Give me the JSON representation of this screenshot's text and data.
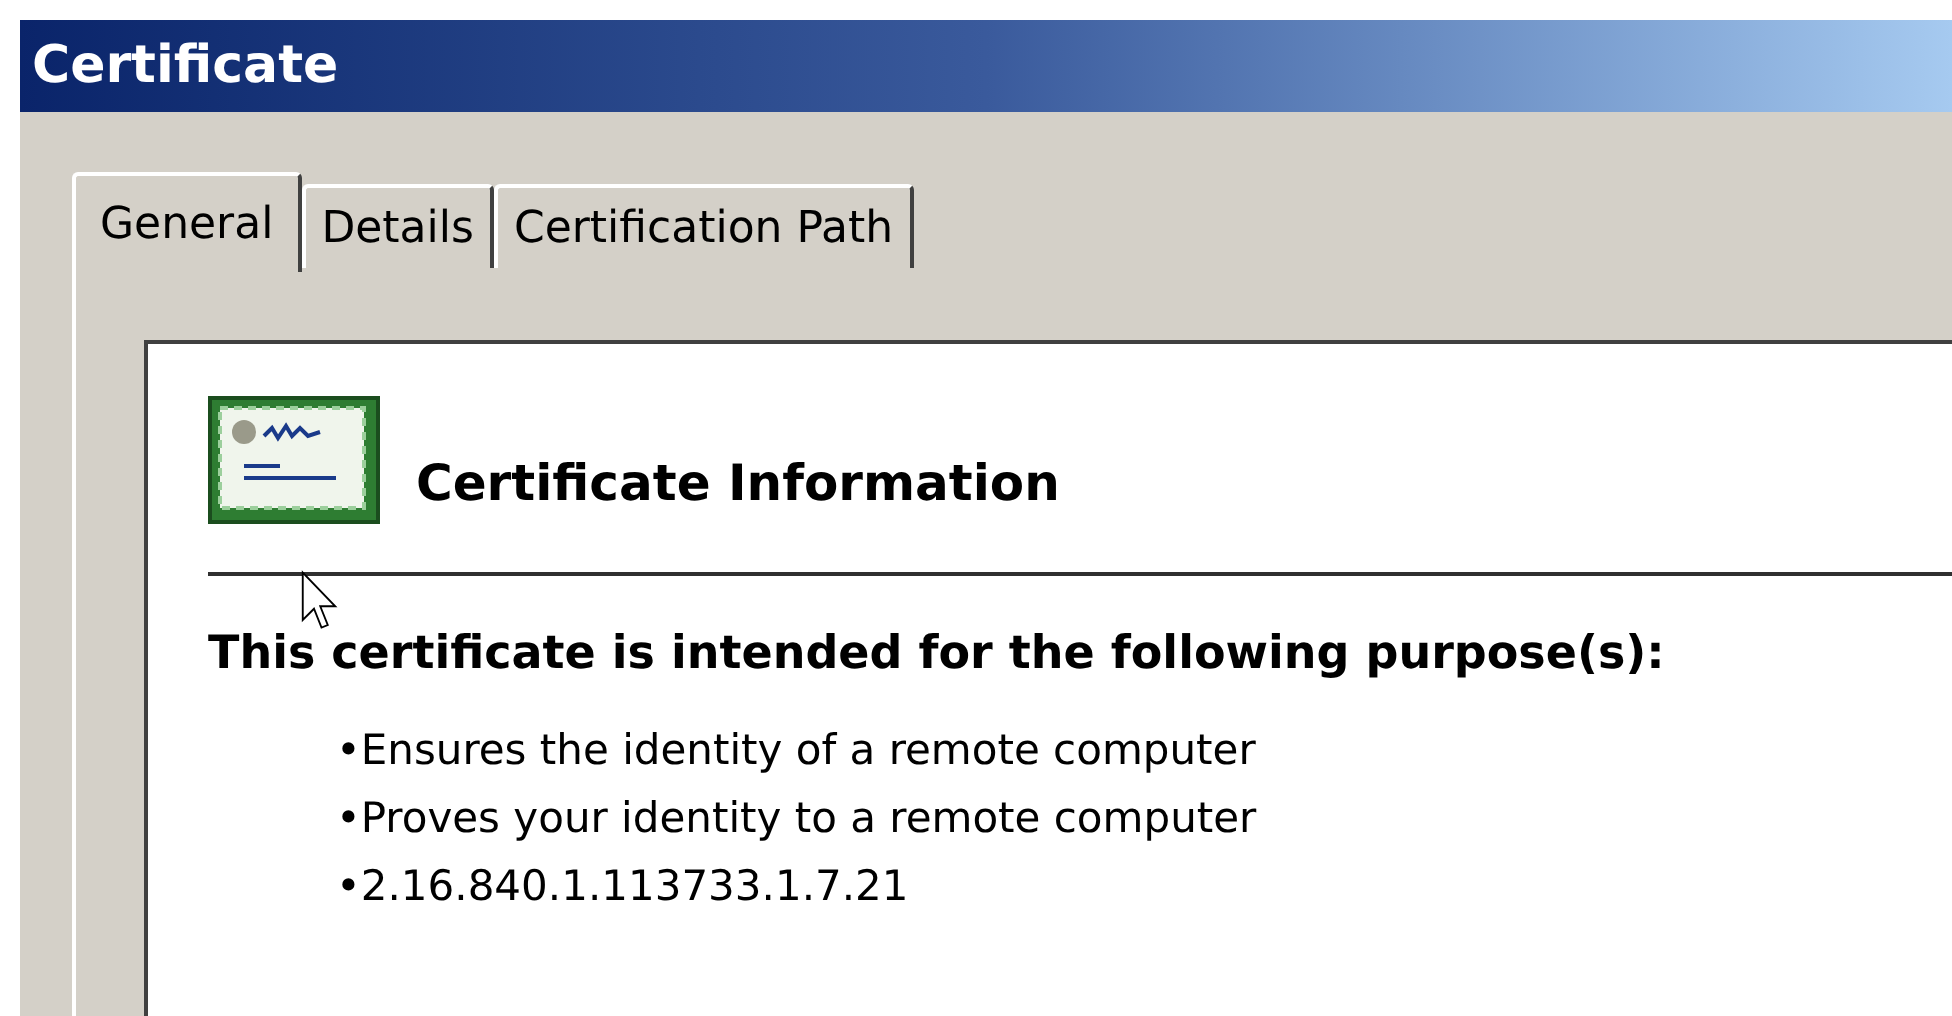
{
  "window": {
    "title": "Certificate"
  },
  "tabs": [
    {
      "label": "General",
      "selected": true
    },
    {
      "label": "Details",
      "selected": false
    },
    {
      "label": "Certification Path",
      "selected": false
    }
  ],
  "panel": {
    "heading": "Certificate Information",
    "purpose_heading": "This certificate is intended for the following purpose(s):",
    "purposes": [
      "•Ensures the identity of a remote computer",
      "•Proves your identity to a remote computer",
      "•2.16.840.1.113733.1.7.21"
    ]
  }
}
